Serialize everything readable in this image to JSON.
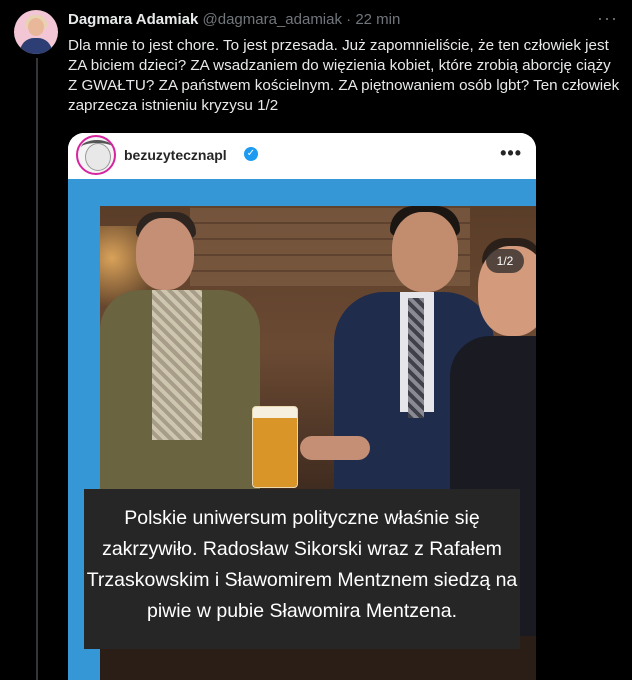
{
  "tweet": {
    "author_name": "Dagmara Adamiak",
    "author_handle": "@dagmara_adamiak",
    "separator": "·",
    "time_ago": "22 min",
    "more_icon": "ellipsis-icon",
    "text": "Dla mnie to jest chore. To jest przesada. Już zapomnieliście, że ten człowiek jest ZA biciem dzieci? ZA wsadzaniem do więzienia kobiet, które zrobią aborcję ciąży Z GWAŁTU? ZA państwem kościelnym. ZA piętnowaniem osób lgbt? Ten człowiek zaprzecza istnieniu kryzysu 1/2"
  },
  "embed": {
    "account_name": "bezuzytecznapl",
    "verified_icon": "verified-check-icon",
    "verified_glyph": "✓",
    "more_glyph": "•••",
    "page_indicator": "1/2",
    "caption": "Polskie uniwersum polityczne właśnie się zakrzywiło. Radosław Sikorski wraz z Rafałem Trzaskowskim i Sławomirem Mentznem siedzą na piwie w pubie Sławomira Mentzena."
  },
  "colors": {
    "background": "#000000",
    "text_primary": "#e7e9ea",
    "text_secondary": "#71767b",
    "verified_blue": "#1d9bf0",
    "media_background": "#3597d5",
    "caption_background": "#262626"
  }
}
